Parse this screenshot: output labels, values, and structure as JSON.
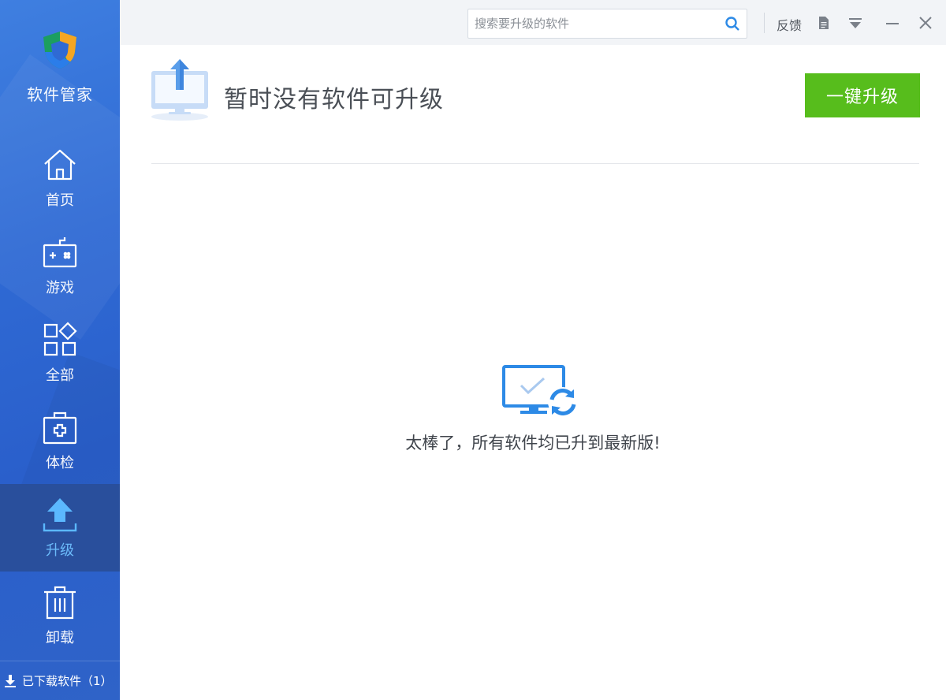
{
  "sidebar": {
    "app_title": "软件管家",
    "items": [
      {
        "id": "home",
        "label": "首页",
        "icon": "home-icon"
      },
      {
        "id": "games",
        "label": "游戏",
        "icon": "gamepad-icon"
      },
      {
        "id": "all",
        "label": "全部",
        "icon": "apps-grid-icon"
      },
      {
        "id": "checkup",
        "label": "体检",
        "icon": "medical-kit-icon"
      },
      {
        "id": "upgrade",
        "label": "升级",
        "icon": "upload-arrow-icon",
        "active": true
      },
      {
        "id": "uninstall",
        "label": "卸载",
        "icon": "trash-icon"
      }
    ],
    "downloads_label": "已下载软件（1）"
  },
  "topbar": {
    "search_placeholder": "搜索要升级的软件",
    "feedback_label": "反馈",
    "icons": [
      "search-icon",
      "document-icon",
      "dropdown-menu-icon",
      "minimize-icon",
      "close-icon"
    ]
  },
  "main": {
    "status_title": "暂时没有软件可升级",
    "upgrade_all_label": "一键升级",
    "empty_message": "太棒了，所有软件均已升到最新版!"
  },
  "colors": {
    "sidebar_blue": "#2f6ad4",
    "sidebar_active": "#294f9c",
    "active_label": "#6fc0ff",
    "button_green": "#57bd1c",
    "icon_blue": "#2d8ae6"
  }
}
